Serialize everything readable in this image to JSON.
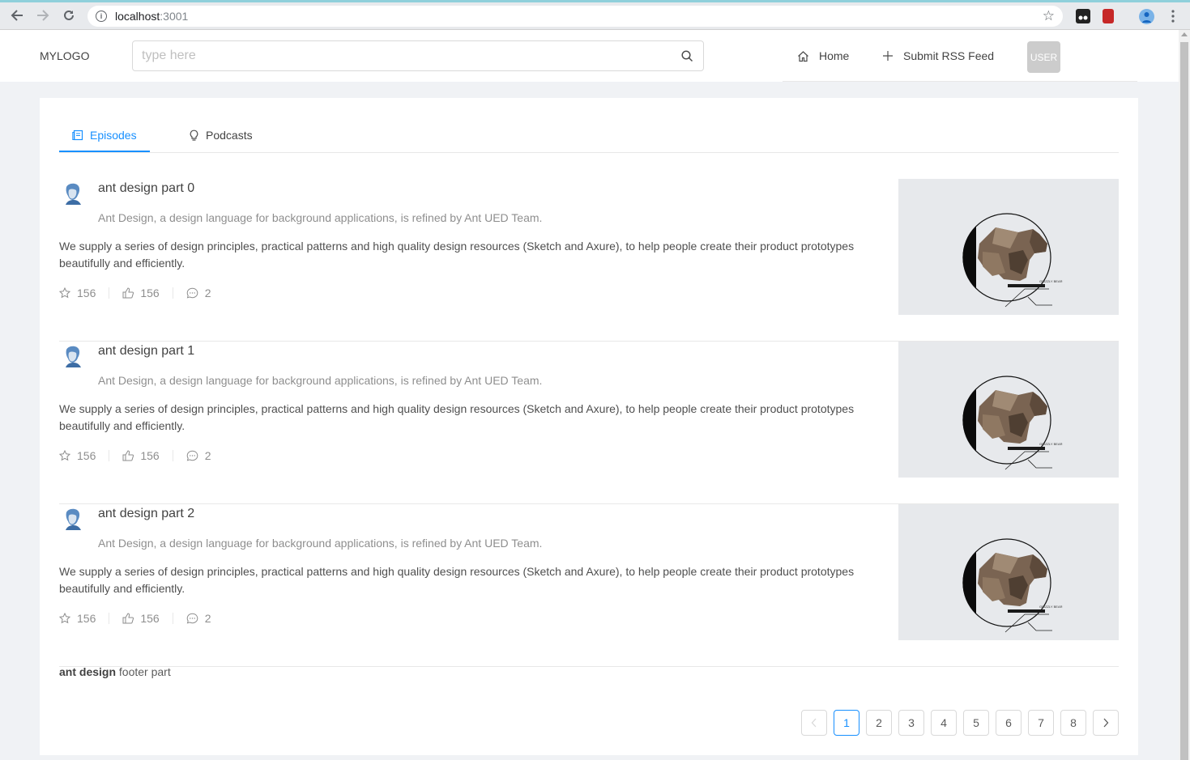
{
  "browser": {
    "url_host": "localhost",
    "url_port": ":3001"
  },
  "header": {
    "logo": "MYLOGO",
    "search_placeholder": "type here",
    "menu": [
      {
        "label": "Home",
        "icon": "home-icon"
      },
      {
        "label": "Submit RSS Feed",
        "icon": "plus-icon"
      }
    ],
    "user_label": "USER"
  },
  "tabs": [
    {
      "label": "Episodes",
      "icon": "container-icon",
      "active": true
    },
    {
      "label": "Podcasts",
      "icon": "bulb-icon",
      "active": false
    }
  ],
  "items": [
    {
      "title": "ant design part 0",
      "description": "Ant Design, a design language for background applications, is refined by Ant UED Team.",
      "content": "We supply a series of design principles, practical patterns and high quality design resources (Sketch and Axure), to help people create their product prototypes beautifully and efficiently.",
      "stars": "156",
      "likes": "156",
      "comments": "2",
      "image_caption": "GRIZZLY BEAR"
    },
    {
      "title": "ant design part 1",
      "description": "Ant Design, a design language for background applications, is refined by Ant UED Team.",
      "content": "We supply a series of design principles, practical patterns and high quality design resources (Sketch and Axure), to help people create their product prototypes beautifully and efficiently.",
      "stars": "156",
      "likes": "156",
      "comments": "2",
      "image_caption": "GRIZZLY BEAR"
    },
    {
      "title": "ant design part 2",
      "description": "Ant Design, a design language for background applications, is refined by Ant UED Team.",
      "content": "We supply a series of design principles, practical patterns and high quality design resources (Sketch and Axure), to help people create their product prototypes beautifully and efficiently.",
      "stars": "156",
      "likes": "156",
      "comments": "2",
      "image_caption": "GRIZZLY BEAR"
    }
  ],
  "footer": {
    "bold": "ant design",
    "rest": " footer part"
  },
  "pagination": {
    "prev": "<",
    "next": ">",
    "pages": [
      "1",
      "2",
      "3",
      "4",
      "5",
      "6",
      "7",
      "8"
    ],
    "current": "1"
  },
  "colors": {
    "primary": "#1890ff",
    "background": "#f0f2f5",
    "image_bg": "#e7e9ec"
  }
}
